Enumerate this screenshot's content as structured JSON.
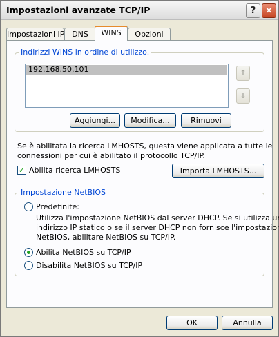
{
  "window": {
    "title": "Impostazioni avanzate TCP/IP",
    "help_label": "?",
    "close_label": "×"
  },
  "tabs": [
    {
      "label": "Impostazioni IP"
    },
    {
      "label": "DNS"
    },
    {
      "label": "WINS"
    },
    {
      "label": "Opzioni"
    }
  ],
  "wins_group": {
    "legend": "Indirizzi WINS in ordine di utilizzo.",
    "entries": [
      "192.168.50.101"
    ],
    "up_arrow": "↑",
    "down_arrow": "↓",
    "add_label": "Aggiungi...",
    "edit_label": "Modifica...",
    "remove_label": "Rimuovi"
  },
  "lmhosts": {
    "description_line1": "Se è abilitata la ricerca LMHOSTS, questa viene applicata a tutte le",
    "description_line2": "connessioni per cui è abilitato il protocollo TCP/IP.",
    "checkbox_label": "Abilita ricerca LMHOSTS",
    "checkbox_checked": true,
    "import_label": "Importa LMHOSTS..."
  },
  "netbios_group": {
    "legend": "Impostazione NetBIOS",
    "options": [
      {
        "label": "Predefinite:",
        "selected": false
      },
      {
        "label": "Abilita NetBIOS su TCP/IP",
        "selected": true
      },
      {
        "label": "Disabilita NetBIOS su TCP/IP",
        "selected": false
      }
    ],
    "default_desc_line1": "Utilizza l'impostazione NetBIOS dal server DHCP. Se si utilizza un",
    "default_desc_line2": "indirizzo IP statico o se il server DHCP non fornisce l'impostazione",
    "default_desc_line3": "NetBIOS, abilitare NetBIOS su TCP/IP."
  },
  "footer": {
    "ok_label": "OK",
    "cancel_label": "Annulla"
  }
}
